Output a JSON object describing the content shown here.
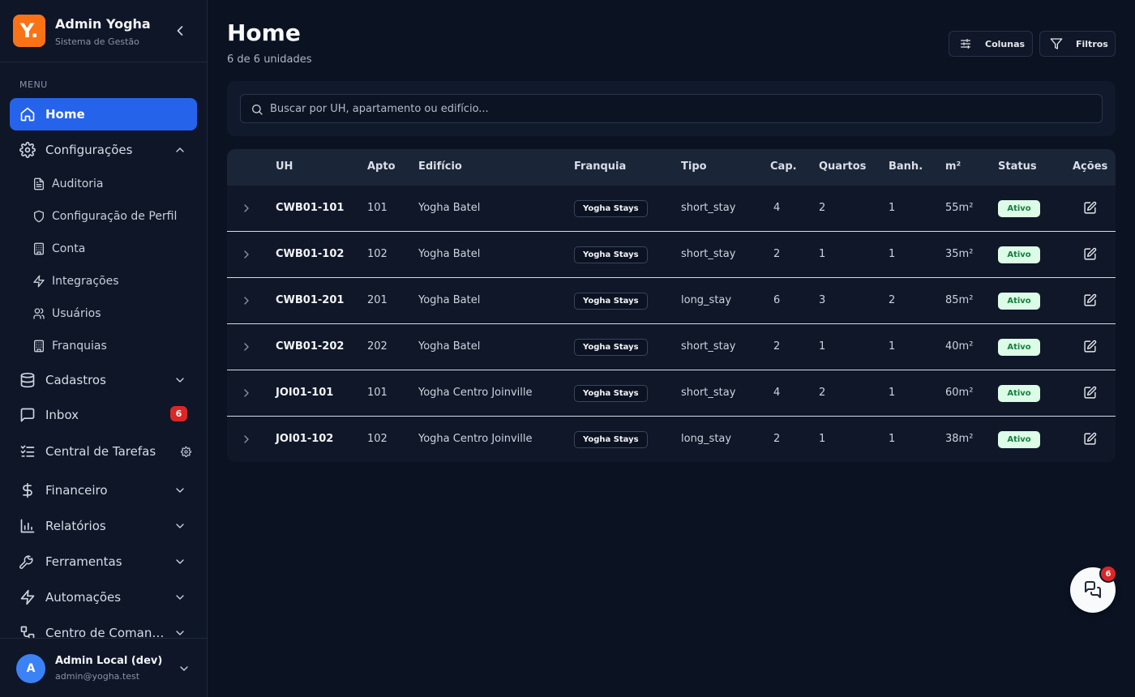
{
  "brand": {
    "logo": "Y.",
    "title": "Admin Yogha",
    "subtitle": "Sistema de Gestão"
  },
  "sidebar": {
    "menu_label": "MENU",
    "items": [
      {
        "label": "Home",
        "icon": "home-icon",
        "active": true
      },
      {
        "label": "Configurações",
        "icon": "gear-icon",
        "expanded": true
      },
      {
        "label": "Cadastros",
        "icon": "database-icon"
      },
      {
        "label": "Inbox",
        "icon": "message-square-icon",
        "badge": "6"
      },
      {
        "label": "Central de Tarefas",
        "icon": "list-checks-icon"
      },
      {
        "label": "Financeiro",
        "icon": "dollar-icon"
      },
      {
        "label": "Relatórios",
        "icon": "bar-chart-icon"
      },
      {
        "label": "Ferramentas",
        "icon": "wrench-icon"
      },
      {
        "label": "Automações",
        "icon": "zap-icon"
      },
      {
        "label": "Centro de Coman…",
        "icon": "workflow-icon"
      }
    ],
    "config_subitems": [
      {
        "label": "Auditoria",
        "icon": "file-text-icon"
      },
      {
        "label": "Configuração de Perfil",
        "icon": "shield-icon"
      },
      {
        "label": "Conta",
        "icon": "building-icon"
      },
      {
        "label": "Integrações",
        "icon": "zap-icon"
      },
      {
        "label": "Usuários",
        "icon": "users-icon"
      },
      {
        "label": "Franquias",
        "icon": "building-icon"
      }
    ]
  },
  "user": {
    "initial": "A",
    "name": "Admin Local (dev)",
    "email": "admin@yogha.test"
  },
  "header": {
    "title": "Home",
    "subtitle": "6 de 6 unidades",
    "columns_button": "Colunas",
    "filters_button": "Filtros"
  },
  "search": {
    "placeholder": "Buscar por UH, apartamento ou edifício..."
  },
  "table": {
    "columns": [
      "UH",
      "Apto",
      "Edifício",
      "Franquia",
      "Tipo",
      "Cap.",
      "Quartos",
      "Banh.",
      "m²",
      "Status",
      "Ações"
    ],
    "rows": [
      {
        "uh": "CWB01-101",
        "apto": "101",
        "edificio": "Yogha Batel",
        "franquia": "Yogha Stays",
        "tipo": "short_stay",
        "cap": "4",
        "quartos": "2",
        "banh": "1",
        "m2": "55m²",
        "status": "Ativo"
      },
      {
        "uh": "CWB01-102",
        "apto": "102",
        "edificio": "Yogha Batel",
        "franquia": "Yogha Stays",
        "tipo": "short_stay",
        "cap": "2",
        "quartos": "1",
        "banh": "1",
        "m2": "35m²",
        "status": "Ativo"
      },
      {
        "uh": "CWB01-201",
        "apto": "201",
        "edificio": "Yogha Batel",
        "franquia": "Yogha Stays",
        "tipo": "long_stay",
        "cap": "6",
        "quartos": "3",
        "banh": "2",
        "m2": "85m²",
        "status": "Ativo"
      },
      {
        "uh": "CWB01-202",
        "apto": "202",
        "edificio": "Yogha Batel",
        "franquia": "Yogha Stays",
        "tipo": "short_stay",
        "cap": "2",
        "quartos": "1",
        "banh": "1",
        "m2": "40m²",
        "status": "Ativo"
      },
      {
        "uh": "JOI01-101",
        "apto": "101",
        "edificio": "Yogha Centro Joinville",
        "franquia": "Yogha Stays",
        "tipo": "short_stay",
        "cap": "4",
        "quartos": "2",
        "banh": "1",
        "m2": "60m²",
        "status": "Ativo"
      },
      {
        "uh": "JOI01-102",
        "apto": "102",
        "edificio": "Yogha Centro Joinville",
        "franquia": "Yogha Stays",
        "tipo": "long_stay",
        "cap": "2",
        "quartos": "1",
        "banh": "1",
        "m2": "38m²",
        "status": "Ativo"
      }
    ]
  },
  "chat": {
    "badge": "6"
  },
  "colors": {
    "accent": "#2563eb",
    "brand": "#f97316",
    "badge": "#dc2626",
    "status_bg": "#dcfce7",
    "status_fg": "#15803d"
  }
}
